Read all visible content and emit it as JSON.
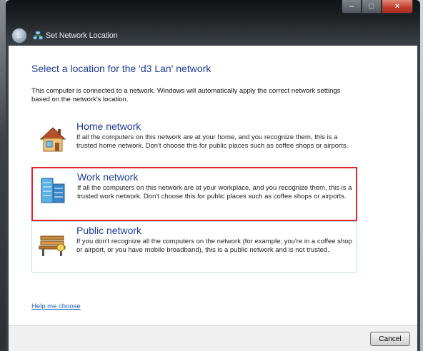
{
  "window": {
    "title": "Set Network Location",
    "controls": {
      "minimize": "–",
      "maximize": "□",
      "close": "×"
    }
  },
  "page": {
    "headline": "Select a location for the 'd3 Lan' network",
    "description": "This computer is connected to a network. Windows will automatically apply the correct network settings based on the network's location."
  },
  "options": [
    {
      "id": "home",
      "title": "Home network",
      "body": "If all the computers on this network are at your home, and you recognize them, this is a trusted home network.  Don't choose this for public places such as coffee shops or airports.",
      "icon": "home-network-icon"
    },
    {
      "id": "work",
      "title": "Work network",
      "body": "If all the computers on this network are at your workplace, and you recognize them, this is a trusted work network.  Don't choose this for public places such as coffee shops or airports.",
      "icon": "work-network-icon",
      "highlighted": true
    },
    {
      "id": "public",
      "title": "Public network",
      "body": "If you don't recognize all the computers on the network (for example, you're in a coffee shop or airport, or you have mobile broadband), this is a public network and is not trusted.",
      "icon": "public-network-icon"
    }
  ],
  "help_link": "Help me choose",
  "footer": {
    "cancel_label": "Cancel"
  },
  "colors": {
    "headline": "#1e3d9b",
    "highlight_border": "#e3252b",
    "link": "#1f5fbf"
  }
}
